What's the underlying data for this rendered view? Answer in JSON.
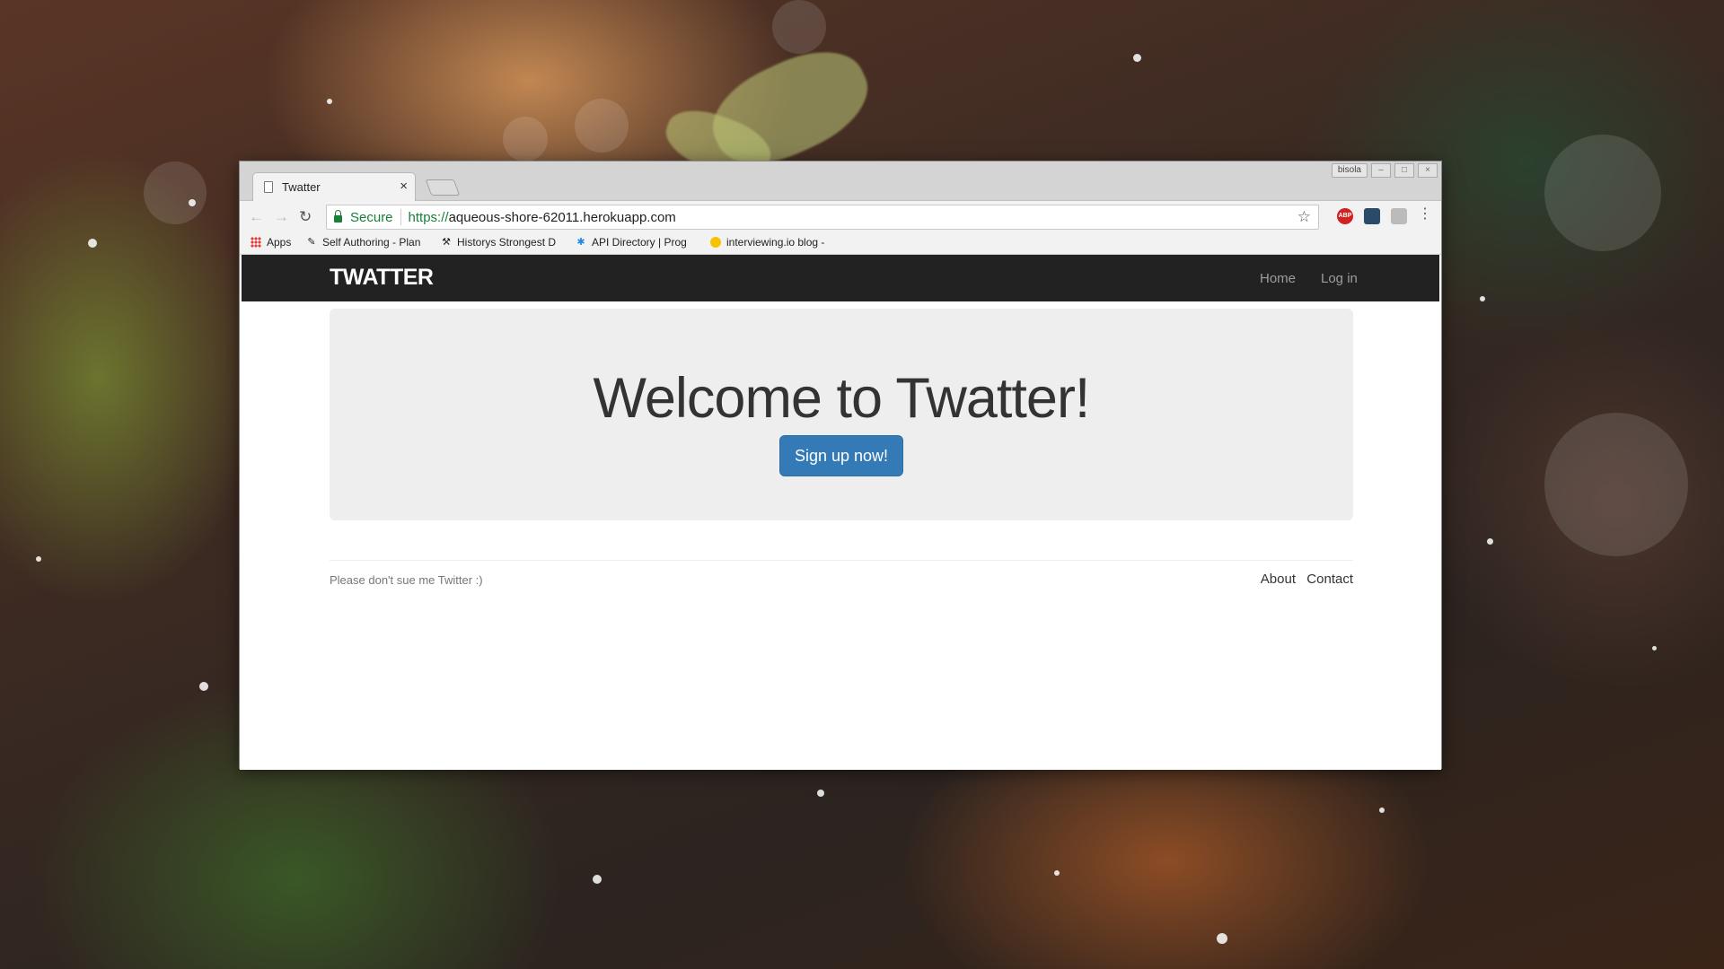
{
  "browser": {
    "tab": {
      "title": "Twatter",
      "close_symbol": "×"
    },
    "user_badge": "bisola",
    "window_buttons": {
      "minimize": "–",
      "maximize": "□",
      "close": "×"
    },
    "nav": {
      "back_symbol": "←",
      "forward_symbol": "→",
      "reload_symbol": "↻"
    },
    "address_bar": {
      "secure_label": "Secure",
      "url_scheme": "https://",
      "url_host": "aqueous-shore-62011.herokuapp.com",
      "star_symbol": "☆"
    },
    "extensions": {
      "abp_label": "ABP"
    },
    "menu_symbol": "⋮",
    "bookmarks": [
      {
        "label": "Apps",
        "icon": "apps-grid-icon"
      },
      {
        "label": "Self Authoring - Plan",
        "icon": "pen-icon"
      },
      {
        "label": "Historys Strongest D",
        "icon": "bookmark-icon"
      },
      {
        "label": "API Directory | Prog",
        "icon": "puzzle-icon"
      },
      {
        "label": "interviewing.io blog -",
        "icon": "interviewing-icon"
      }
    ]
  },
  "site": {
    "brand": "TWATTER",
    "nav_links": [
      "Home",
      "Log in"
    ],
    "hero": {
      "title": "Welcome to Twatter!",
      "cta_label": "Sign up now!",
      "cta_color": "#337ab7"
    },
    "footer": {
      "note": "Please don't sue me Twitter :)",
      "links": [
        "About",
        "Contact"
      ]
    },
    "navbar_color": "#222222"
  }
}
